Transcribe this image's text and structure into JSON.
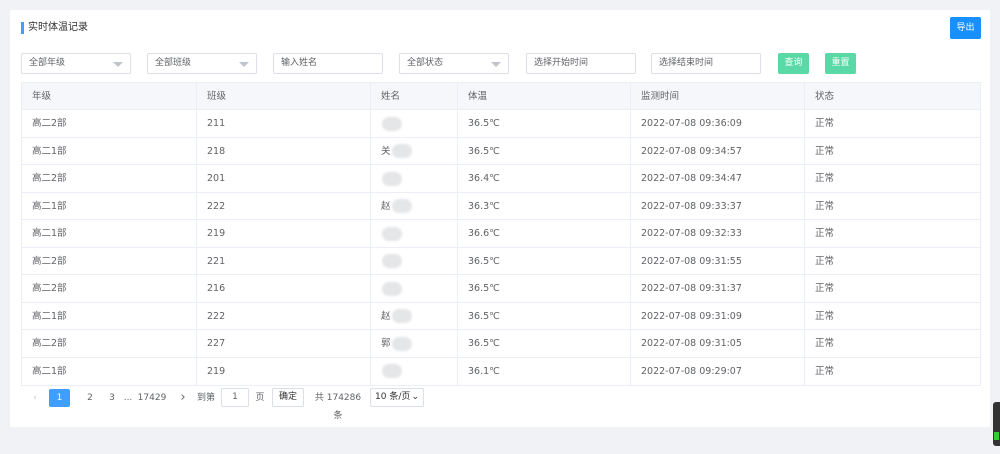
{
  "header": {
    "title": "实时体温记录",
    "export_label": "导出"
  },
  "filters": {
    "grade": "全部年级",
    "class": "全部班级",
    "name_placeholder": "输入姓名",
    "status": "全部状态",
    "start_placeholder": "选择开始时间",
    "end_placeholder": "选择结束时间",
    "query_label": "查询",
    "reset_label": "重置"
  },
  "table": {
    "columns": [
      "年级",
      "班级",
      "姓名",
      "体温",
      "监测时间",
      "状态"
    ],
    "rows": [
      {
        "grade": "高二2部",
        "class": "211",
        "name": "",
        "temp": "36.5℃",
        "time": "2022-07-08 09:36:09",
        "status": "正常"
      },
      {
        "grade": "高二1部",
        "class": "218",
        "name": "关",
        "temp": "36.5℃",
        "time": "2022-07-08 09:34:57",
        "status": "正常"
      },
      {
        "grade": "高二2部",
        "class": "201",
        "name": "",
        "temp": "36.4℃",
        "time": "2022-07-08 09:34:47",
        "status": "正常"
      },
      {
        "grade": "高二1部",
        "class": "222",
        "name": "赵",
        "temp": "36.3℃",
        "time": "2022-07-08 09:33:37",
        "status": "正常"
      },
      {
        "grade": "高二1部",
        "class": "219",
        "name": "",
        "temp": "36.6℃",
        "time": "2022-07-08 09:32:33",
        "status": "正常"
      },
      {
        "grade": "高二2部",
        "class": "221",
        "name": "",
        "temp": "36.5℃",
        "time": "2022-07-08 09:31:55",
        "status": "正常"
      },
      {
        "grade": "高二2部",
        "class": "216",
        "name": "",
        "temp": "36.5℃",
        "time": "2022-07-08 09:31:37",
        "status": "正常"
      },
      {
        "grade": "高二1部",
        "class": "222",
        "name": "赵",
        "temp": "36.5℃",
        "time": "2022-07-08 09:31:09",
        "status": "正常"
      },
      {
        "grade": "高二2部",
        "class": "227",
        "name": "郭",
        "temp": "36.5℃",
        "time": "2022-07-08 09:31:05",
        "status": "正常"
      },
      {
        "grade": "高二1部",
        "class": "219",
        "name": "",
        "temp": "36.1℃",
        "time": "2022-07-08 09:29:07",
        "status": "正常"
      }
    ]
  },
  "pagination": {
    "prev_icon": "chevron-left-icon",
    "pages": [
      "1",
      "2",
      "3"
    ],
    "ellipsis": "...",
    "last_page": "17429",
    "next_icon": "chevron-right-icon",
    "goto_label": "到第",
    "current": "1",
    "page_unit": "页",
    "confirm_label": "确定",
    "total_text": "共 174286 条",
    "page_size": "10 条/页"
  },
  "colors": {
    "primary": "#1890ff",
    "active_page": "#409eff",
    "action_green": "#5ad8a6"
  }
}
